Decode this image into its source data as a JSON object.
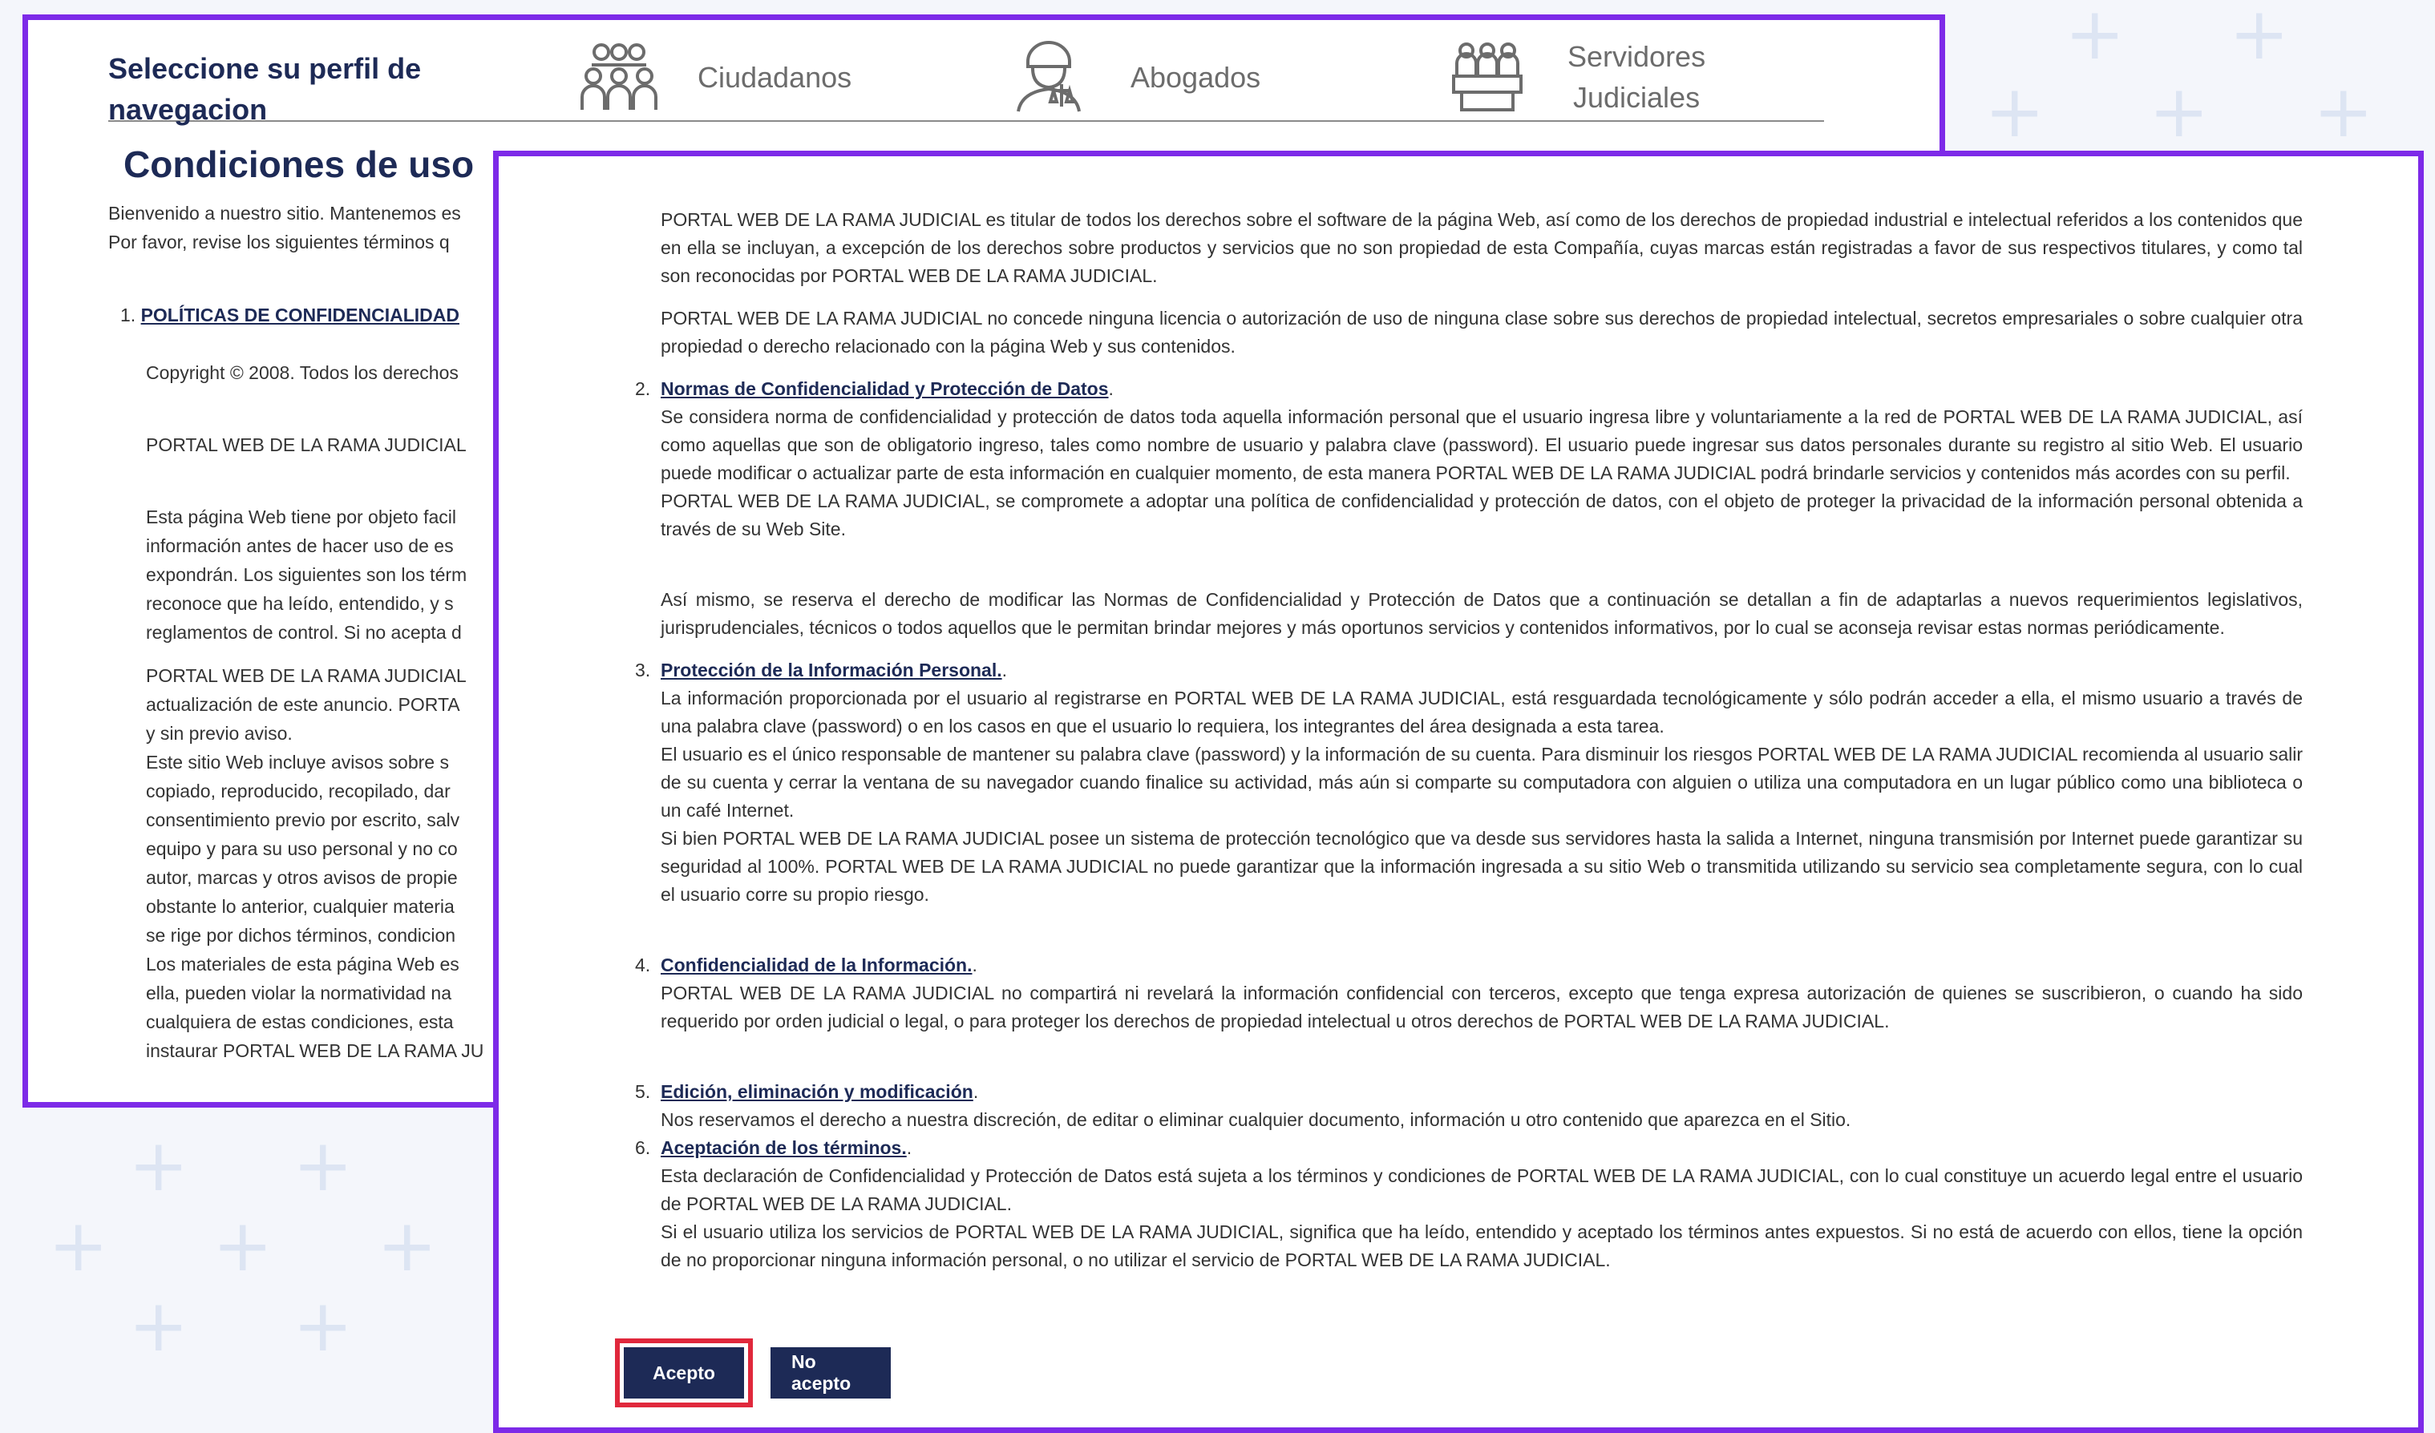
{
  "header": {
    "profile_title_line1": "Seleccione su perfil de",
    "profile_title_line2": "navegacion",
    "profiles": [
      {
        "label": "Ciudadanos",
        "icon": "citizens-group-icon"
      },
      {
        "label": "Abogados",
        "icon": "lawyer-scales-icon"
      },
      {
        "label_line1": "Servidores",
        "label_line2": "Judiciales",
        "icon": "judicial-servers-icon"
      }
    ]
  },
  "back_page": {
    "title": "Condiciones de uso",
    "intro_line1": "Bienvenido a nuestro sitio. Mantenemos es",
    "intro_line2": "Por favor, revise los siguientes términos q",
    "section1_num": "1.",
    "section1_title": "POLÍTICAS DE CONFIDENCIALIDAD",
    "copyright": "Copyright © 2008. Todos los derechos",
    "portal_line": "PORTAL WEB DE LA RAMA JUDICIAL",
    "para1": [
      "Esta página Web tiene por objeto facil",
      "información antes de hacer uso de es",
      "expondrán. Los siguientes son los térm",
      "reconoce que ha leído, entendido, y s",
      "reglamentos de control. Si no acepta d"
    ],
    "para2": [
      "PORTAL WEB DE LA RAMA JUDICIAL",
      "actualización de este anuncio. PORTA",
      "y sin previo aviso.",
      "Este sitio Web incluye avisos sobre s",
      "copiado, reproducido, recopilado, dar",
      "consentimiento previo por escrito, salv",
      "equipo y para su uso personal y no co",
      "autor, marcas y otros avisos de propie",
      "obstante lo anterior, cualquier materia",
      "se rige por dichos términos, condicion",
      "Los materiales de esta página Web es",
      "ella, pueden violar la normatividad na",
      "cualquiera de estas condiciones, esta",
      "instaurar PORTAL WEB DE LA RAMA JU"
    ]
  },
  "terms": {
    "p1": "PORTAL WEB DE LA RAMA JUDICIAL es titular de todos los derechos sobre el software de la página Web, así como de los derechos de propiedad industrial e intelectual referidos a los contenidos que en ella se incluyan, a excepción de los derechos sobre productos y servicios que no son propiedad de esta Compañía, cuyas marcas están registradas a favor de sus respectivos titulares, y como tal son reconocidas por PORTAL WEB DE LA RAMA JUDICIAL.",
    "p2": "PORTAL WEB DE LA RAMA JUDICIAL no concede ninguna licencia o autorización de uso de ninguna clase sobre sus derechos de propiedad intelectual, secretos empresariales o sobre cualquier otra propiedad o derecho relacionado con la página Web y sus contenidos.",
    "s2_num": "2.",
    "s2_title": "Normas de Confidencialidad y Protección de Datos",
    "s2_suffix": ".",
    "s2_p1": "Se considera norma de confidencialidad y protección de datos toda aquella información personal que el usuario ingresa libre y voluntariamente a la red de PORTAL WEB DE LA RAMA JUDICIAL, así como aquellas que son de obligatorio ingreso, tales como nombre de usuario y palabra clave (password). El usuario puede ingresar sus datos personales durante su registro al sitio Web. El usuario puede modificar o actualizar parte de esta información en cualquier momento, de esta manera PORTAL WEB DE LA RAMA JUDICIAL podrá brindarle servicios y contenidos más acordes con su perfil.",
    "s2_p2": "PORTAL WEB DE LA RAMA JUDICIAL, se compromete a adoptar una política de confidencialidad y protección de datos, con el objeto de proteger la privacidad de la información personal obtenida a través de su Web Site.",
    "s2_p3": "Así mismo, se reserva el derecho de modificar las Normas de Confidencialidad y Protección de Datos que a continuación se detallan a fin de adaptarlas a nuevos requerimientos legislativos, jurisprudenciales, técnicos o todos aquellos que le permitan brindar mejores y más oportunos servicios y contenidos informativos, por lo cual se aconseja revisar estas normas periódicamente.",
    "s3_num": "3.",
    "s3_title": "Protección de la Información Personal.",
    "s3_suffix": ".",
    "s3_p1": "La información proporcionada por el usuario al registrarse en PORTAL WEB DE LA RAMA JUDICIAL, está resguardada tecnológicamente y sólo podrán acceder a ella, el mismo usuario a través de una palabra clave (password) o en los casos en que el usuario lo requiera, los integrantes del área designada a esta tarea.",
    "s3_p2": "El usuario es el único responsable de mantener su palabra clave (password) y la información de su cuenta. Para disminuir los riesgos PORTAL WEB DE LA RAMA JUDICIAL recomienda al usuario salir de su cuenta y cerrar la ventana de su navegador cuando finalice su actividad, más aún si comparte su computadora con alguien o utiliza una computadora en un lugar público como una biblioteca o un café Internet.",
    "s3_p3": "Si bien PORTAL WEB DE LA RAMA JUDICIAL posee un sistema de protección tecnológico que va desde sus servidores hasta la salida a Internet, ninguna transmisión por Internet puede garantizar su seguridad al 100%. PORTAL WEB DE LA RAMA JUDICIAL no puede garantizar que la información ingresada a su sitio Web o transmitida utilizando su servicio sea completamente segura, con lo cual el usuario corre su propio riesgo.",
    "s4_num": "4.",
    "s4_title": "Confidencialidad de la Información.",
    "s4_suffix": ".",
    "s4_p1": "PORTAL WEB DE LA RAMA JUDICIAL no compartirá ni revelará la información confidencial con terceros, excepto que tenga expresa autorización de quienes se suscribieron, o cuando ha sido requerido por orden judicial o legal, o para proteger los derechos de propiedad intelectual u otros derechos de PORTAL WEB DE LA RAMA JUDICIAL.",
    "s5_num": "5.",
    "s5_title": "Edición, eliminación y modificación",
    "s5_suffix": ".",
    "s5_p1": "Nos reservamos el derecho a nuestra discreción, de editar o eliminar cualquier documento, información u otro contenido que aparezca en el Sitio.",
    "s6_num": "6.",
    "s6_title": "Aceptación de los términos.",
    "s6_suffix": ".",
    "s6_p1": "Esta declaración de Confidencialidad y Protección de Datos está sujeta a los términos y condiciones de PORTAL WEB DE LA RAMA JUDICIAL, con lo cual constituye un acuerdo legal entre el usuario de PORTAL WEB DE LA RAMA JUDICIAL.",
    "s6_p2": "Si el usuario utiliza los servicios de PORTAL WEB DE LA RAMA JUDICIAL, significa que ha leído, entendido y aceptado los términos antes expuestos. Si no está de acuerdo con ellos, tiene la opción de no proporcionar ninguna información personal, o no utilizar el servicio de PORTAL WEB DE LA RAMA JUDICIAL."
  },
  "buttons": {
    "accept": "Acepto",
    "reject": "No acepto"
  },
  "colors": {
    "accent_border": "#7d2ae8",
    "primary_navy": "#1d2a56",
    "focus_red": "#e0283c"
  }
}
